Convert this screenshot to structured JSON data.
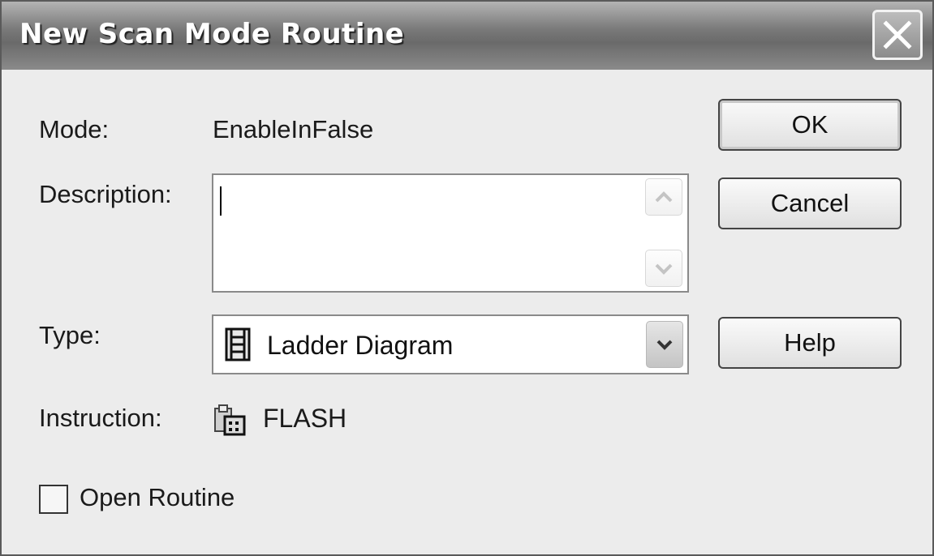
{
  "window": {
    "title": "New Scan Mode Routine"
  },
  "form": {
    "mode_label": "Mode:",
    "mode_value": "EnableInFalse",
    "description_label": "Description:",
    "description_value": "",
    "type_label": "Type:",
    "type_value": "Ladder Diagram",
    "type_icon": "ladder-diagram-icon",
    "instruction_label": "Instruction:",
    "instruction_value": "FLASH",
    "instruction_icon": "instruction-icon",
    "open_routine_label": "Open Routine",
    "open_routine_checked": false
  },
  "buttons": {
    "ok": "OK",
    "cancel": "Cancel",
    "help": "Help"
  }
}
